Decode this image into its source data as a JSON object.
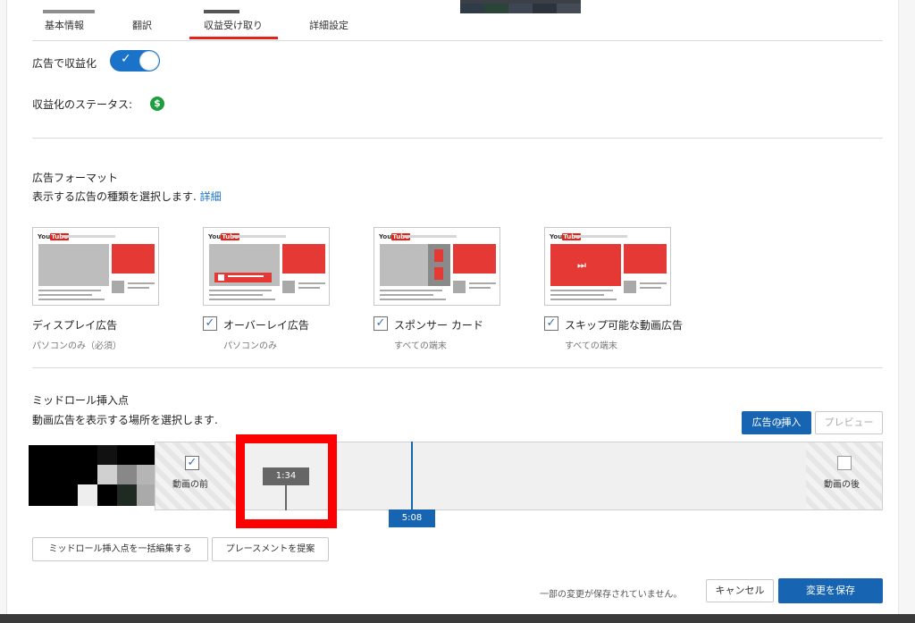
{
  "tabs": [
    {
      "label": "基本情報"
    },
    {
      "label": "翻訳"
    },
    {
      "label": "収益受け取り"
    },
    {
      "label": "詳細設定"
    }
  ],
  "monetize": {
    "label": "広告で収益化",
    "enabled": true,
    "status_label": "収益化のステータス:",
    "status_icon": "dollar-icon",
    "status_color": "#1e9e3e"
  },
  "ad_formats": {
    "title": "広告フォーマット",
    "description": "表示する広告の種類を選択します.",
    "details_link": "詳細",
    "items": [
      {
        "name": "ディスプレイ広告",
        "sub": "パソコンのみ（必須）",
        "checked": false
      },
      {
        "name": "オーバーレイ広告",
        "sub": "パソコンのみ",
        "checked": true
      },
      {
        "name": "スポンサー カード",
        "sub": "すべての端末",
        "checked": true
      },
      {
        "name": "スキップ可能な動画広告",
        "sub": "すべての端末",
        "checked": true
      }
    ],
    "logo_text": "You",
    "logo_badge": "Tube"
  },
  "midroll": {
    "title": "ミッドロール挿入点",
    "description": "動画広告を表示する場所を選択します.",
    "insert_button": "広告の挿入",
    "preview_button": "プレビュー",
    "before_label": "動画の前",
    "before_checked": true,
    "after_label": "動画の後",
    "after_checked": false,
    "marker_time": "1:34",
    "playhead_time": "5:08",
    "bulk_edit_button": "ミッドロール挿入点を一括編集する",
    "suggest_button": "プレースメントを提案"
  },
  "footer": {
    "unsaved_text": "一部の変更が保存されていません。",
    "cancel_button": "キャンセル",
    "save_button": "変更を保存"
  },
  "colors": {
    "accent": "#1764b3",
    "highlight": "#ff0000",
    "youtube_red": "#e62117"
  }
}
